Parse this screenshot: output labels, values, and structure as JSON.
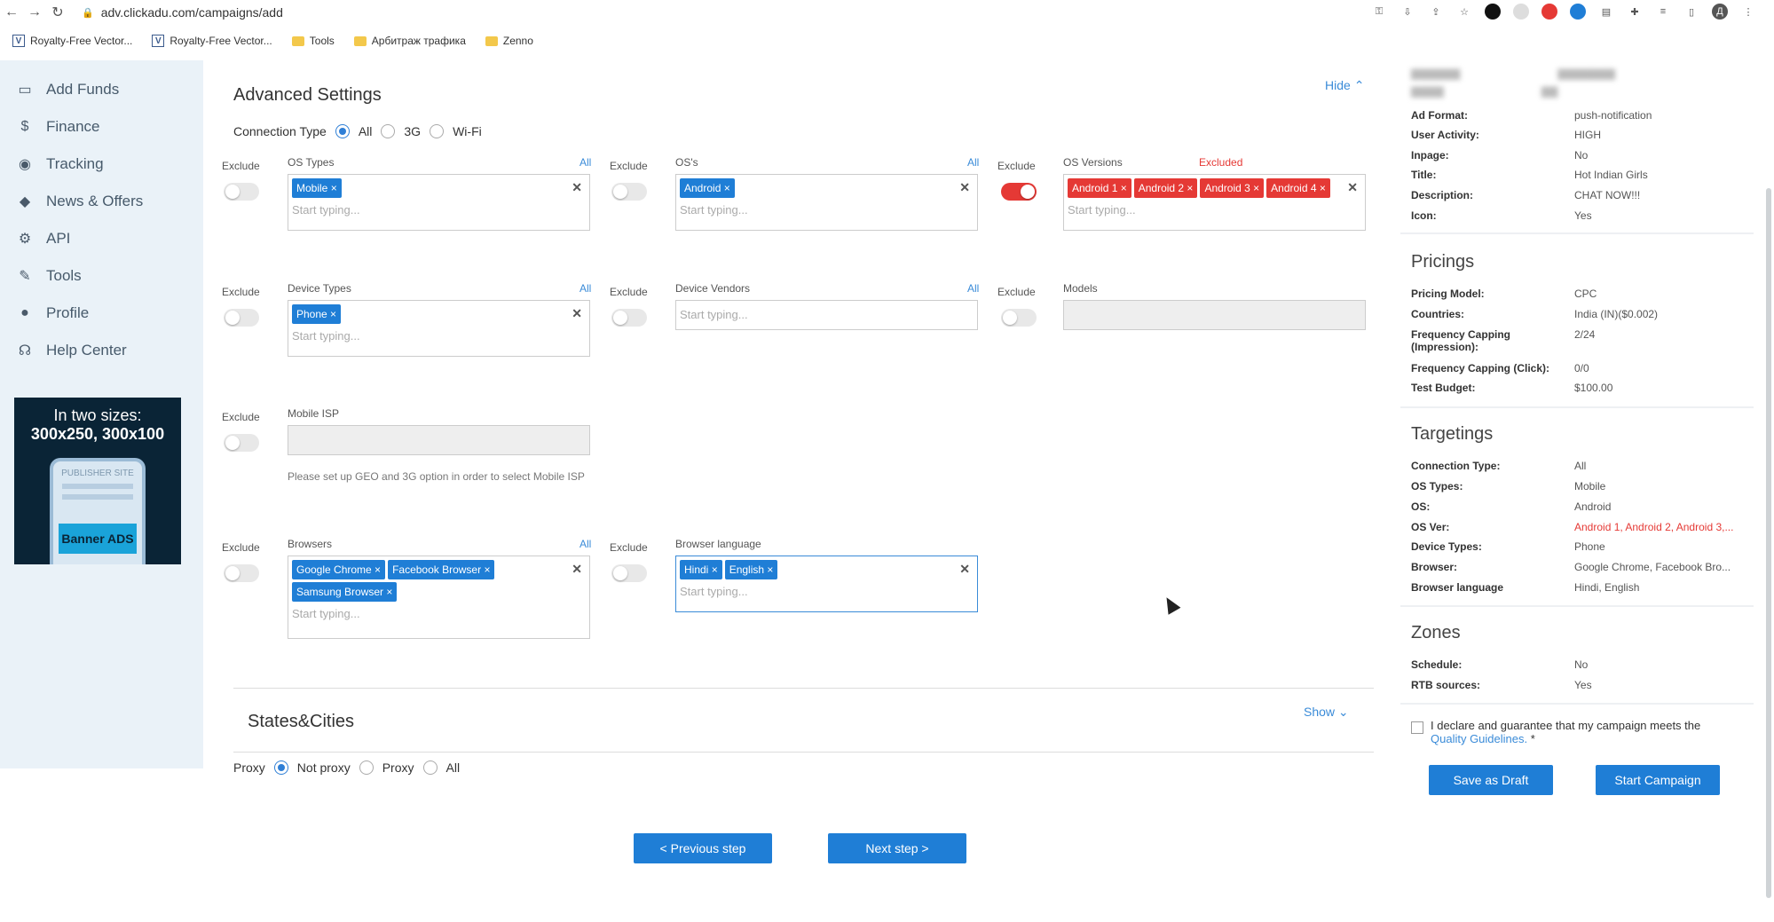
{
  "browser": {
    "url": "adv.clickadu.com/campaigns/add",
    "bookmarks": [
      "Royalty-Free Vector...",
      "Royalty-Free Vector...",
      "Tools",
      "Арбитраж трафика",
      "Zenno"
    ]
  },
  "sidebar": {
    "items": [
      {
        "label": "Add Funds",
        "icon": "wallet-icon",
        "glyph": "▭"
      },
      {
        "label": "Finance",
        "icon": "dollar-icon",
        "glyph": "$"
      },
      {
        "label": "Tracking",
        "icon": "eye-icon",
        "glyph": "◉"
      },
      {
        "label": "News & Offers",
        "icon": "diamond-icon",
        "glyph": "◆"
      },
      {
        "label": "API",
        "icon": "gears-icon",
        "glyph": "⚙"
      },
      {
        "label": "Tools",
        "icon": "wrench-icon",
        "glyph": "✎"
      },
      {
        "label": "Profile",
        "icon": "user-icon",
        "glyph": "●"
      },
      {
        "label": "Help Center",
        "icon": "headset-icon",
        "glyph": "☊"
      }
    ],
    "banner": {
      "line1": "In two sizes:",
      "line2": "300x250, 300x100",
      "site": "PUBLISHER SITE",
      "ad": "Banner ADS"
    }
  },
  "advanced": {
    "title": "Advanced Settings",
    "hide": "Hide",
    "connection_label": "Connection Type",
    "connection_options": [
      "All",
      "3G",
      "Wi-Fi"
    ],
    "exclude": "Exclude",
    "all": "All",
    "placeholder": "Start typing...",
    "excluded": "Excluded",
    "os_types": {
      "label": "OS Types",
      "chips": [
        "Mobile"
      ]
    },
    "oss": {
      "label": "OS's",
      "chips": [
        "Android"
      ]
    },
    "os_versions": {
      "label": "OS Versions",
      "chips": [
        "Android 1",
        "Android 2",
        "Android 3",
        "Android 4"
      ]
    },
    "device_types": {
      "label": "Device Types",
      "chips": [
        "Phone"
      ]
    },
    "device_vendors": {
      "label": "Device Vendors"
    },
    "models": {
      "label": "Models"
    },
    "mobile_isp": {
      "label": "Mobile ISP",
      "hint": "Please set up GEO and 3G option in order to select Mobile ISP"
    },
    "browsers": {
      "label": "Browsers",
      "chips": [
        "Google Chrome",
        "Facebook Browser",
        "Samsung Browser"
      ]
    },
    "browser_language": {
      "label": "Browser language",
      "chips": [
        "Hindi",
        "English"
      ]
    }
  },
  "states": {
    "title": "States&Cities",
    "show": "Show",
    "proxy_label": "Proxy",
    "proxy_options": [
      "Not proxy",
      "Proxy",
      "All"
    ]
  },
  "nav": {
    "prev": "< Previous step",
    "next": "Next step >"
  },
  "summary": {
    "top": [
      {
        "k": "Ad Format:",
        "v": "push-notification"
      },
      {
        "k": "User Activity:",
        "v": "HIGH"
      },
      {
        "k": "Inpage:",
        "v": "No"
      },
      {
        "k": "Title:",
        "v": "Hot Indian Girls"
      },
      {
        "k": "Description:",
        "v": "CHAT NOW!!!"
      },
      {
        "k": "Icon:",
        "v": "Yes"
      }
    ],
    "pricings_title": "Pricings",
    "pricings": [
      {
        "k": "Pricing Model:",
        "v": "CPC"
      },
      {
        "k": "Countries:",
        "v": "India (IN)($0.002)"
      },
      {
        "k": "Frequency Capping (Impression):",
        "v": "2/24"
      },
      {
        "k": "Frequency Capping (Click):",
        "v": "0/0"
      },
      {
        "k": "Test Budget:",
        "v": "$100.00"
      }
    ],
    "targetings_title": "Targetings",
    "targetings": [
      {
        "k": "Connection Type:",
        "v": "All"
      },
      {
        "k": "OS Types:",
        "v": "Mobile"
      },
      {
        "k": "OS:",
        "v": "Android"
      },
      {
        "k": "OS Ver:",
        "v": "Android 1, Android 2, Android 3,..."
      },
      {
        "k": "Device Types:",
        "v": "Phone"
      },
      {
        "k": "Browser:",
        "v": "Google Chrome, Facebook Bro..."
      },
      {
        "k": "Browser language",
        "v": "Hindi, English"
      }
    ],
    "zones_title": "Zones",
    "zones": [
      {
        "k": "Schedule:",
        "v": "No"
      },
      {
        "k": "RTB sources:",
        "v": "Yes"
      }
    ],
    "declare_text": "I declare and guarantee that my campaign meets the",
    "declare_link": "Quality Guidelines.",
    "declare_star": "*",
    "save_draft": "Save as Draft",
    "start": "Start Campaign"
  },
  "colors": {
    "accent": "#1f7ed6",
    "excluded": "#e53935",
    "sidebar_bg": "#eaf2f8"
  }
}
